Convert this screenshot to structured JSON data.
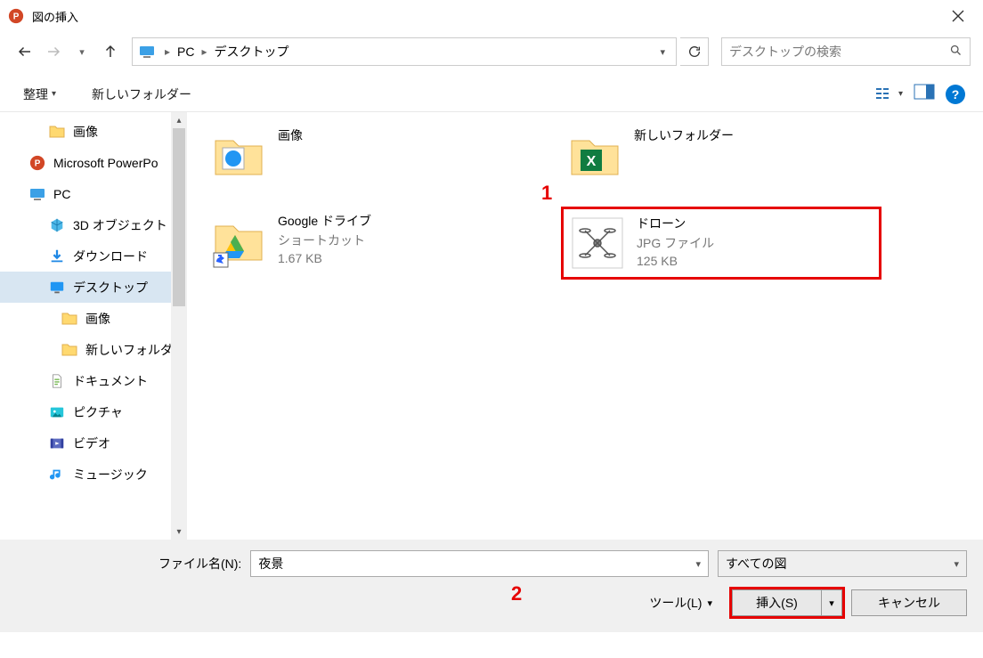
{
  "titlebar": {
    "title": "図の挿入"
  },
  "breadcrumb": {
    "root": "PC",
    "folder": "デスクトップ"
  },
  "search": {
    "placeholder": "デスクトップの検索"
  },
  "toolbar": {
    "organize": "整理",
    "newFolder": "新しいフォルダー"
  },
  "tree": [
    {
      "label": "画像",
      "icon": "folder",
      "indent": 1
    },
    {
      "label": "Microsoft PowerPo",
      "icon": "powerpoint",
      "indent": 0
    },
    {
      "label": "PC",
      "icon": "pc",
      "indent": 0
    },
    {
      "label": "3D オブジェクト",
      "icon": "3d",
      "indent": 1
    },
    {
      "label": "ダウンロード",
      "icon": "download",
      "indent": 1
    },
    {
      "label": "デスクトップ",
      "icon": "desktop",
      "indent": 1,
      "selected": true
    },
    {
      "label": "画像",
      "icon": "folder",
      "indent": 2
    },
    {
      "label": "新しいフォルダー",
      "icon": "folder",
      "indent": 2
    },
    {
      "label": "ドキュメント",
      "icon": "documents",
      "indent": 1
    },
    {
      "label": "ピクチャ",
      "icon": "pictures",
      "indent": 1
    },
    {
      "label": "ビデオ",
      "icon": "videos",
      "indent": 1
    },
    {
      "label": "ミュージック",
      "icon": "music",
      "indent": 1
    }
  ],
  "items": [
    {
      "name": "画像",
      "type": "folder-image"
    },
    {
      "name": "新しいフォルダー",
      "type": "folder-excel"
    },
    {
      "name": "Google ドライブ",
      "sub1": "ショートカット",
      "sub2": "1.67 KB",
      "type": "shortcut-drive"
    },
    {
      "name": "ドローン",
      "sub1": "JPG ファイル",
      "sub2": "125 KB",
      "type": "image-drone",
      "highlighted": true
    }
  ],
  "annotations": {
    "one": "1",
    "two": "2"
  },
  "bottom": {
    "filenameLabel": "ファイル名(N):",
    "filenameValue": "夜景",
    "filterLabel": "すべての図",
    "tools": "ツール(L)",
    "insert": "挿入(S)",
    "cancel": "キャンセル"
  }
}
